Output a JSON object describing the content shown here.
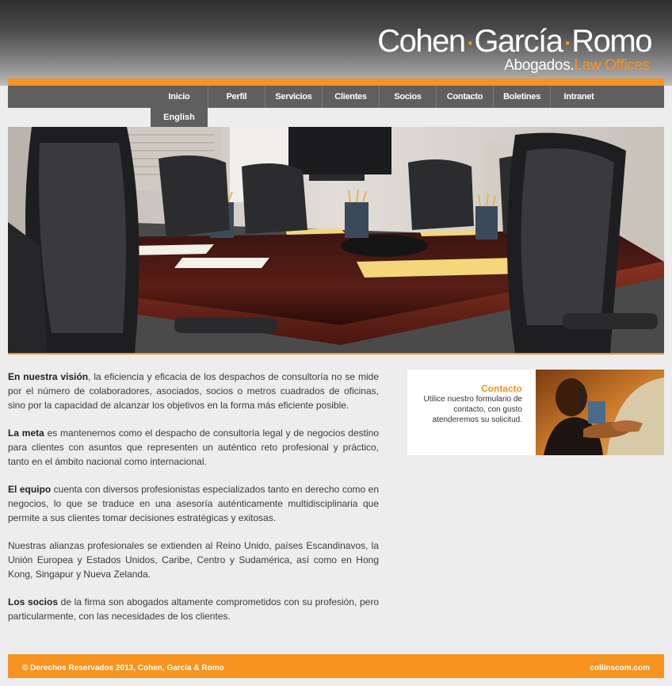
{
  "header": {
    "logo_name_1": "Cohen",
    "logo_name_2": "García",
    "logo_name_3": "Romo",
    "logo_separator": "·",
    "logo_sub_1": "Abogados.",
    "logo_sub_2": "Law Offices"
  },
  "colors": {
    "accent": "#f7931e",
    "nav_bg": "#5f5f5f",
    "page_bg": "#ededed"
  },
  "nav": {
    "items": [
      {
        "label": "Inicio"
      },
      {
        "label": "Perfil"
      },
      {
        "label": "Servicios"
      },
      {
        "label": "Clientes"
      },
      {
        "label": "Socios"
      },
      {
        "label": "Contacto"
      },
      {
        "label": "Boletines"
      },
      {
        "label": "Intranet"
      }
    ],
    "sub_item": "English"
  },
  "content": {
    "p1_bold": "En nuestra visión",
    "p1_text": ", la eficiencia y eficacia de los despachos de consultoría no se mide por el número de colaboradores, asociados, socios o metros cuadrados de oficinas, sino por la capacidad de alcanzar los objetivos en la forma más eficiente posible.",
    "p2_bold": "La meta",
    "p2_text": " es mantenernos como el despacho de consultoría legal y de negocios destino para clientes con asuntos que representen un auténtico reto profesional y práctico, tanto en el ámbito nacional como internacional.",
    "p3_bold": "El equipo",
    "p3_text": " cuenta con diversos profesionistas especializados tanto en derecho como en negocios, lo que se traduce en una asesoría auténticamente multidisciplinaria que permite a sus clientes tomar decisiones estratégicas y exitosas.",
    "p4_text": "Nuestras alianzas profesionales se extienden al Reino Unido, países Escandinavos, la Unión Europea y Estados Unidos, Caribe, Centro y Sudamérica, así como en Hong Kong, Singapur y Nueva Zelanda.",
    "p5_bold": "Los socios",
    "p5_text": " de la firma son abogados altamente comprometidos con su profesión, pero particularmente, con las necesidades de los clientes."
  },
  "contact": {
    "title": "Contacto",
    "line1": "Utilice nuestro formulario de",
    "line2": "contacto, con gusto",
    "line3": "atenderemos su solicitud."
  },
  "footer": {
    "copyright": "© Derechos Reservados 2013, Cohen, García & Romo",
    "credit": "collinscom.com"
  }
}
